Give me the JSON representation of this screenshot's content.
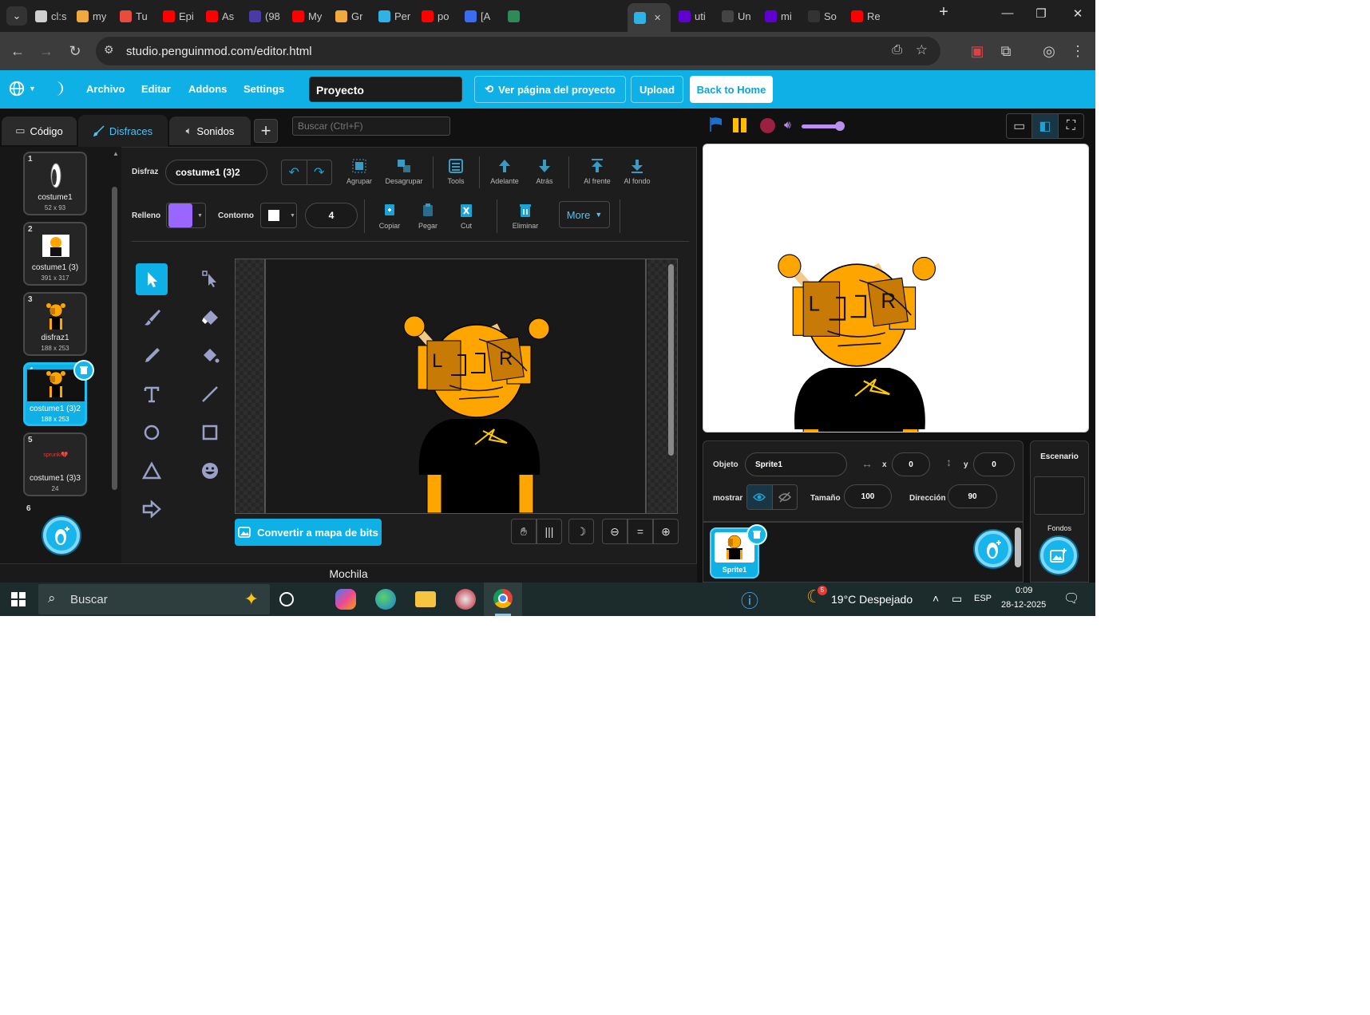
{
  "browser": {
    "tabs": [
      {
        "label": "cl:s",
        "color": "#cfcfcf"
      },
      {
        "label": "my",
        "color": "#f0a93c"
      },
      {
        "label": "Tu",
        "color": "#e74c3c"
      },
      {
        "label": "Epi",
        "color": "#ff0000"
      },
      {
        "label": "As",
        "color": "#ff0000"
      },
      {
        "label": "(98",
        "color": "#4a3aa8"
      },
      {
        "label": "My",
        "color": "#ff0000"
      },
      {
        "label": "Gr",
        "color": "#f0a93c"
      },
      {
        "label": "Per",
        "color": "#2fb3e6"
      },
      {
        "label": "po",
        "color": "#ff0000"
      },
      {
        "label": "[A",
        "color": "#3a6df0"
      },
      {
        "label": "",
        "color": "#2e8b57"
      },
      {
        "label": "",
        "color": "#2fb3e6",
        "active": true
      },
      {
        "label": "uti",
        "color": "#6001d2"
      },
      {
        "label": "Un",
        "color": "#444444"
      },
      {
        "label": "mi",
        "color": "#6001d2"
      },
      {
        "label": "So",
        "color": "#333333"
      },
      {
        "label": "Re",
        "color": "#ff0000"
      }
    ],
    "url": "studio.penguinmod.com/editor.html"
  },
  "menu": {
    "archivo": "Archivo",
    "editar": "Editar",
    "addons": "Addons",
    "settings": "Settings",
    "project_name": "Proyecto",
    "ver_pagina": "Ver página del proyecto",
    "upload": "Upload",
    "back_home": "Back to Home"
  },
  "editor_tabs": {
    "code": "Código",
    "costumes": "Disfraces",
    "sounds": "Sonidos"
  },
  "search": {
    "placeholder": "Buscar (Ctrl+F)"
  },
  "costumes": [
    {
      "num": "1",
      "name": "costume1",
      "size": "52 x 93"
    },
    {
      "num": "2",
      "name": "costume1 (3)",
      "size": "391 x 317"
    },
    {
      "num": "3",
      "name": "disfraz1",
      "size": "188 x 253"
    },
    {
      "num": "4",
      "name": "costume1 (3)2",
      "size": "188 x 253",
      "selected": true
    },
    {
      "num": "5",
      "name": "costume1 (3)3",
      "size": "24",
      "thumb_text": "sprunki💔"
    },
    {
      "num": "6",
      "name": "",
      "size": ""
    }
  ],
  "paint": {
    "disfraz_label": "Disfraz",
    "costume_name": "costume1 (3)2",
    "agrupar": "Agrupar",
    "desagrupar": "Desagrupar",
    "tools": "Tools",
    "adelante": "Adelante",
    "atras": "Atrás",
    "al_frente": "Al frente",
    "al_fondo": "Al fondo",
    "relleno": "Relleno",
    "fill_color": "#9966ff",
    "contorno": "Contorno",
    "outline_color": "#ffffff",
    "outline_width": "4",
    "copiar": "Copiar",
    "pegar": "Pegar",
    "cut": "Cut",
    "eliminar": "Eliminar",
    "more": "More",
    "convert": "Convertir a mapa de bits"
  },
  "mochila": "Mochila",
  "sprite": {
    "objeto_label": "Objeto",
    "name": "Sprite1",
    "x_label": "x",
    "x": "0",
    "y_label": "y",
    "y": "0",
    "mostrar_label": "mostrar",
    "tamano_label": "Tamaño",
    "size": "100",
    "direccion_label": "Dirección",
    "direction": "90",
    "list_item": "Sprite1"
  },
  "stage_panel": {
    "title": "Escenario",
    "fondos": "Fondos"
  },
  "taskbar": {
    "search": "Buscar",
    "weather_badge": "5",
    "weather": "19°C  Despejado",
    "lang": "ESP",
    "time": "0:09",
    "date": "28-12-2025"
  },
  "colors": {
    "accent": "#0fb0e6",
    "character": "#ffa500",
    "character_dark": "#c77a05"
  }
}
